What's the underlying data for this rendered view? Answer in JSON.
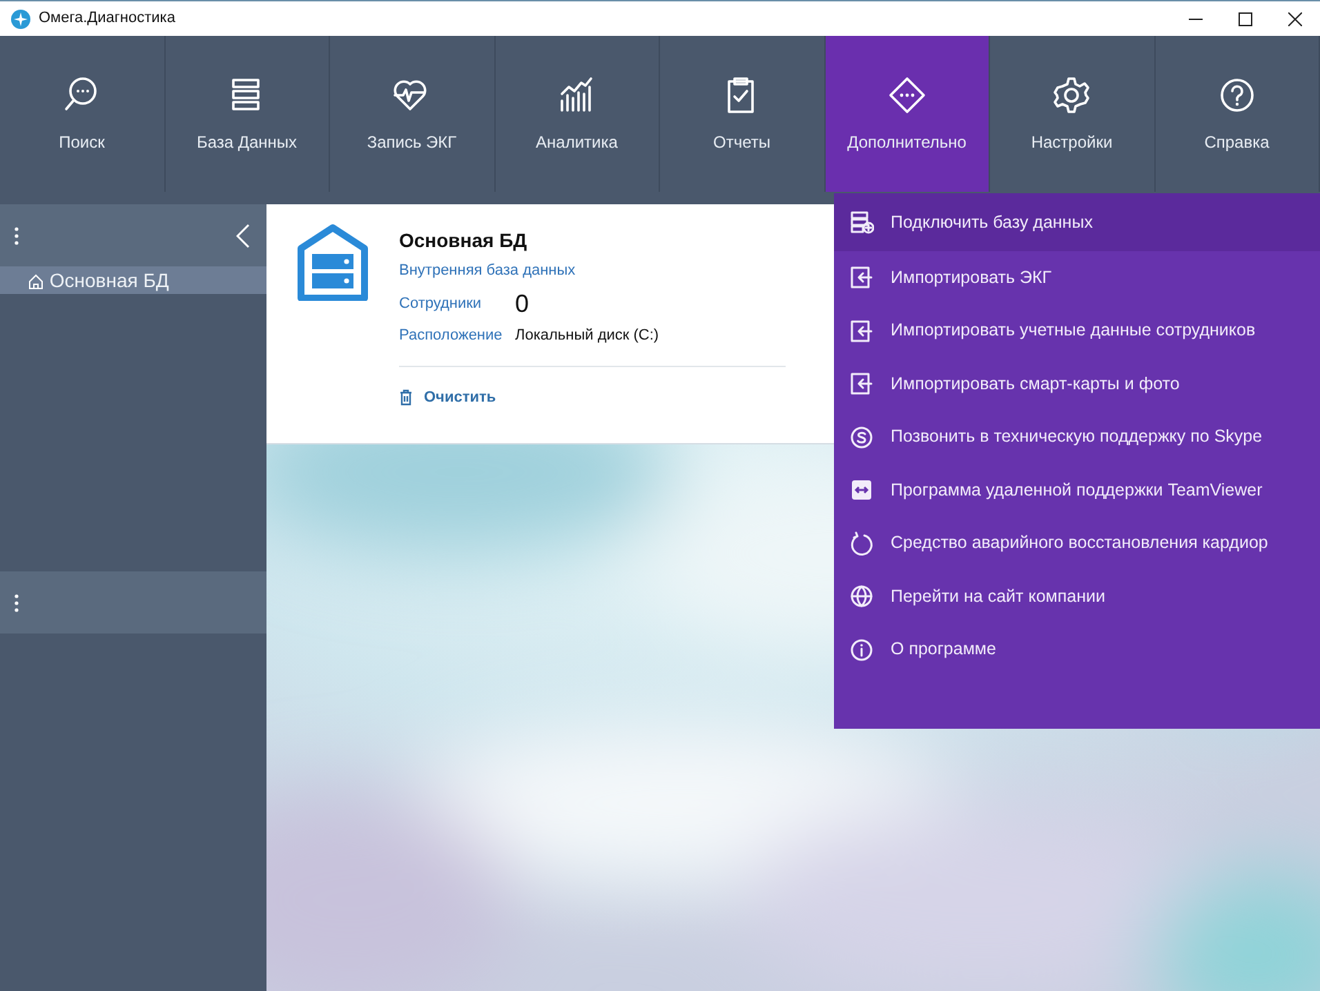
{
  "window": {
    "title": "Омега.Диагностика"
  },
  "toolbar": [
    {
      "label": "Поиск",
      "selected": false
    },
    {
      "label": "База Данных",
      "selected": false
    },
    {
      "label": "Запись ЭКГ",
      "selected": false
    },
    {
      "label": "Аналитика",
      "selected": false
    },
    {
      "label": "Отчеты",
      "selected": false
    },
    {
      "label": "Дополнительно",
      "selected": true
    },
    {
      "label": "Настройки",
      "selected": false
    },
    {
      "label": "Справка",
      "selected": false
    }
  ],
  "sidebar": {
    "items": [
      {
        "label": "Основная БД",
        "selected": true
      }
    ]
  },
  "card": {
    "title": "Основная БД",
    "subtitle": "Внутренняя база данных",
    "fields": [
      {
        "label": "Сотрудники",
        "value": "0",
        "kind": "count"
      },
      {
        "label": "Расположение",
        "value": "Локальный диск (C:)",
        "kind": "text"
      }
    ],
    "action": "Очистить"
  },
  "menu": {
    "items": [
      {
        "label": "Подключить базу данных",
        "selected": true
      },
      {
        "label": "Импортировать ЭКГ",
        "selected": false
      },
      {
        "label": "Импортировать учетные данные сотрудников",
        "selected": false
      },
      {
        "label": "Импортировать смарт-карты и фото",
        "selected": false
      },
      {
        "label": "Позвонить в техническую поддержку по Skype",
        "selected": false
      },
      {
        "label": "Программа удаленной поддержки TeamViewer",
        "selected": false
      },
      {
        "label": "Средство аварийного восстановления кардиор",
        "selected": false
      },
      {
        "label": "Перейти на сайт компании",
        "selected": false
      },
      {
        "label": "О программе",
        "selected": false
      }
    ]
  }
}
